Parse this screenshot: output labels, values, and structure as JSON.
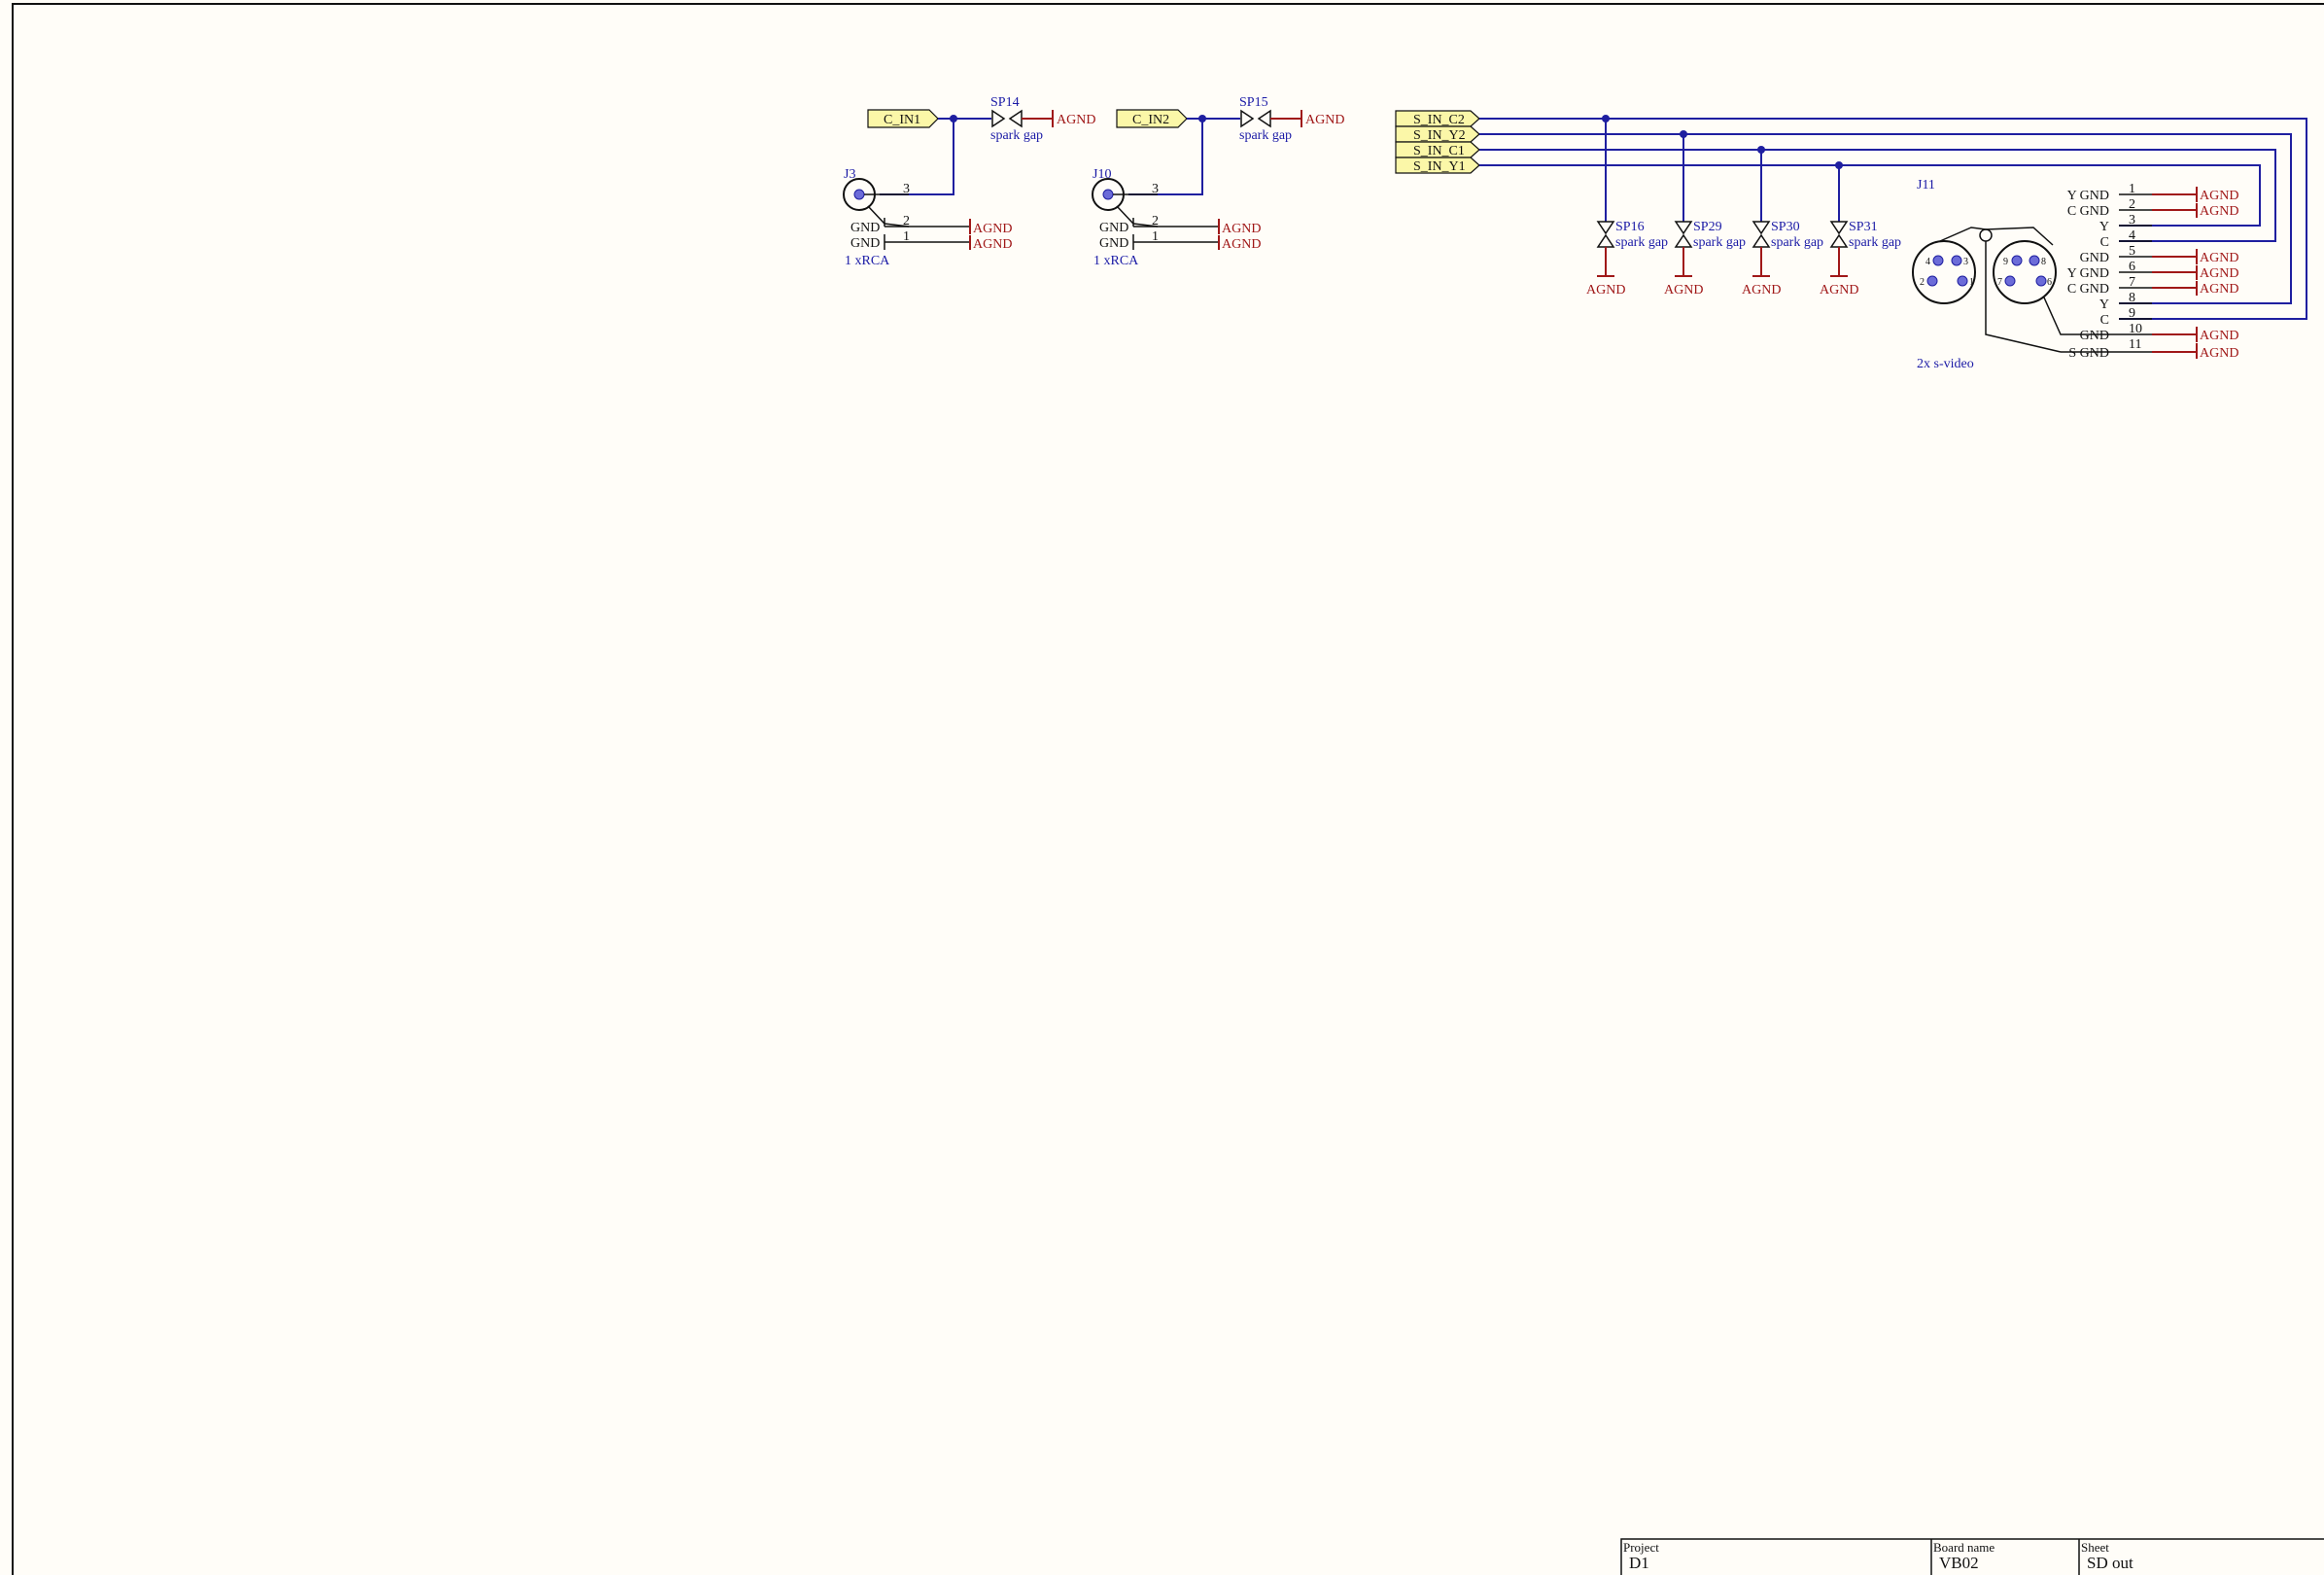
{
  "colors": {
    "background": "#fffdf8",
    "wire": "#1f1fa0",
    "component": "#1a1a1a",
    "ground": "#a01818",
    "netflag_fill": "#fbf7a8",
    "pin_fill": "#6c6cd8"
  },
  "power": {
    "agnd": "AGND"
  },
  "rca": [
    {
      "ref": "J3",
      "value": "1 xRCA",
      "pins": [
        "3",
        "2",
        "1"
      ],
      "pin_names": [
        "GND",
        "GND"
      ],
      "net": "C_IN1",
      "spark_ref": "SP14",
      "spark_value": "spark gap"
    },
    {
      "ref": "J10",
      "value": "1 xRCA",
      "pins": [
        "3",
        "2",
        "1"
      ],
      "pin_names": [
        "GND",
        "GND"
      ],
      "net": "C_IN2",
      "spark_ref": "SP15",
      "spark_value": "spark gap"
    }
  ],
  "svideo_nets": [
    "S_IN_C2",
    "S_IN_Y2",
    "S_IN_C1",
    "S_IN_Y1"
  ],
  "svideo_sparks": [
    {
      "ref": "SP16",
      "value": "spark gap"
    },
    {
      "ref": "SP29",
      "value": "spark gap"
    },
    {
      "ref": "SP30",
      "value": "spark gap"
    },
    {
      "ref": "SP31",
      "value": "spark gap"
    }
  ],
  "j11": {
    "ref": "J11",
    "value": "2x s-video",
    "connector_pins_left": [
      "4",
      "3",
      "2",
      "1"
    ],
    "connector_pins_right": [
      "9",
      "8",
      "7",
      "6"
    ],
    "pins": [
      {
        "name": "Y GND",
        "num": "1"
      },
      {
        "name": "C GND",
        "num": "2"
      },
      {
        "name": "Y",
        "num": "3"
      },
      {
        "name": "C",
        "num": "4"
      },
      {
        "name": "GND",
        "num": "5"
      },
      {
        "name": "Y GND",
        "num": "6"
      },
      {
        "name": "C GND",
        "num": "7"
      },
      {
        "name": "Y",
        "num": "8"
      },
      {
        "name": "C",
        "num": "9"
      },
      {
        "name": "GND",
        "num": "10"
      },
      {
        "name": "S GND",
        "num": "11"
      }
    ]
  },
  "title_block": {
    "project_label": "Project",
    "project_value": "D1",
    "board_label": "Board name",
    "board_value": "VB02",
    "sheet_label": "Sheet",
    "sheet_value": "SD out"
  }
}
